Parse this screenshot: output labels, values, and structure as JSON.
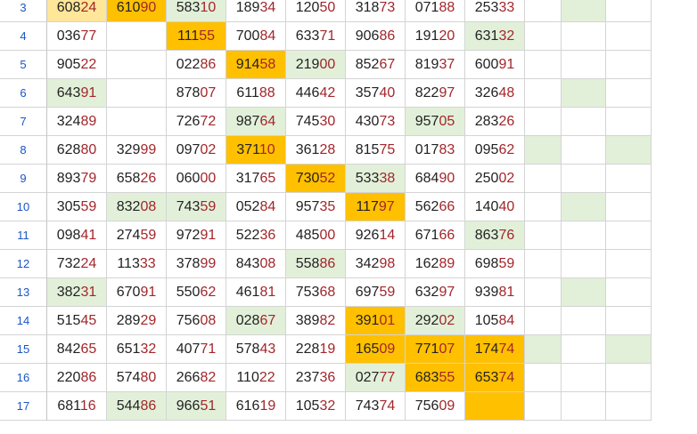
{
  "sheet": {
    "row_numbers": [
      "3",
      "4",
      "5",
      "6",
      "7",
      "8",
      "9",
      "10",
      "11",
      "12",
      "13",
      "14",
      "15",
      "16",
      "17"
    ],
    "highlight_colors": {
      "none": "#ffffff",
      "light_green": "#e2f0d9",
      "orange": "#ffc000",
      "light_orange": "#ffe699",
      "row_number_color": "#1a56c4",
      "first_three_digits": "#222222",
      "last_two_digits": "#a3262b"
    },
    "rows": [
      {
        "cells": [
          {
            "v": "60824",
            "f": 3
          },
          {
            "v": "61090",
            "f": 2
          },
          {
            "v": "58310",
            "f": 1
          },
          {
            "v": "18934",
            "f": 0
          },
          {
            "v": "12050",
            "f": 0
          },
          {
            "v": "31873",
            "f": 0
          },
          {
            "v": "07188",
            "f": 0
          },
          {
            "v": "25333",
            "f": 0
          },
          {
            "v": "",
            "f": 0
          },
          {
            "v": "",
            "f": 1
          },
          {
            "v": "",
            "f": 0
          }
        ]
      },
      {
        "cells": [
          {
            "v": "03677",
            "f": 0
          },
          {
            "v": "",
            "f": 0
          },
          {
            "v": "11155",
            "f": 2
          },
          {
            "v": "70084",
            "f": 0
          },
          {
            "v": "63371",
            "f": 0
          },
          {
            "v": "90686",
            "f": 0
          },
          {
            "v": "19120",
            "f": 0
          },
          {
            "v": "63132",
            "f": 1
          },
          {
            "v": "",
            "f": 0
          },
          {
            "v": "",
            "f": 0
          },
          {
            "v": "",
            "f": 0
          }
        ]
      },
      {
        "cells": [
          {
            "v": "90522",
            "f": 0
          },
          {
            "v": "",
            "f": 0
          },
          {
            "v": "02286",
            "f": 0
          },
          {
            "v": "91458",
            "f": 2
          },
          {
            "v": "21900",
            "f": 1
          },
          {
            "v": "85267",
            "f": 0
          },
          {
            "v": "81937",
            "f": 0
          },
          {
            "v": "60091",
            "f": 0
          },
          {
            "v": "",
            "f": 0
          },
          {
            "v": "",
            "f": 0
          },
          {
            "v": "",
            "f": 0
          }
        ]
      },
      {
        "cells": [
          {
            "v": "64391",
            "f": 1
          },
          {
            "v": "",
            "f": 0
          },
          {
            "v": "87807",
            "f": 0
          },
          {
            "v": "61188",
            "f": 0
          },
          {
            "v": "44642",
            "f": 0
          },
          {
            "v": "35740",
            "f": 0
          },
          {
            "v": "82297",
            "f": 0
          },
          {
            "v": "32648",
            "f": 0
          },
          {
            "v": "",
            "f": 0
          },
          {
            "v": "",
            "f": 1
          },
          {
            "v": "",
            "f": 0
          }
        ]
      },
      {
        "cells": [
          {
            "v": "32489",
            "f": 0
          },
          {
            "v": "",
            "f": 0
          },
          {
            "v": "72672",
            "f": 0
          },
          {
            "v": "98764",
            "f": 1
          },
          {
            "v": "74530",
            "f": 0
          },
          {
            "v": "43073",
            "f": 0
          },
          {
            "v": "95705",
            "f": 1
          },
          {
            "v": "28326",
            "f": 0
          },
          {
            "v": "",
            "f": 0
          },
          {
            "v": "",
            "f": 0
          },
          {
            "v": "",
            "f": 0
          }
        ]
      },
      {
        "cells": [
          {
            "v": "62880",
            "f": 0
          },
          {
            "v": "32999",
            "f": 0
          },
          {
            "v": "09702",
            "f": 0
          },
          {
            "v": "37110",
            "f": 2
          },
          {
            "v": "36128",
            "f": 0
          },
          {
            "v": "81575",
            "f": 0
          },
          {
            "v": "01783",
            "f": 0
          },
          {
            "v": "09562",
            "f": 0
          },
          {
            "v": "",
            "f": 1
          },
          {
            "v": "",
            "f": 0
          },
          {
            "v": "",
            "f": 1
          }
        ]
      },
      {
        "cells": [
          {
            "v": "89379",
            "f": 0
          },
          {
            "v": "65826",
            "f": 0
          },
          {
            "v": "06000",
            "f": 0
          },
          {
            "v": "31765",
            "f": 0
          },
          {
            "v": "73052",
            "f": 2
          },
          {
            "v": "53338",
            "f": 1
          },
          {
            "v": "68490",
            "f": 0
          },
          {
            "v": "25002",
            "f": 0
          },
          {
            "v": "",
            "f": 0
          },
          {
            "v": "",
            "f": 0
          },
          {
            "v": "",
            "f": 0
          }
        ]
      },
      {
        "cells": [
          {
            "v": "30559",
            "f": 0
          },
          {
            "v": "83208",
            "f": 1
          },
          {
            "v": "74359",
            "f": 1
          },
          {
            "v": "05284",
            "f": 0
          },
          {
            "v": "95735",
            "f": 0
          },
          {
            "v": "11797",
            "f": 2
          },
          {
            "v": "56266",
            "f": 0
          },
          {
            "v": "14040",
            "f": 0
          },
          {
            "v": "",
            "f": 0
          },
          {
            "v": "",
            "f": 1
          },
          {
            "v": "",
            "f": 0
          }
        ]
      },
      {
        "cells": [
          {
            "v": "09841",
            "f": 0
          },
          {
            "v": "27459",
            "f": 0
          },
          {
            "v": "97291",
            "f": 0
          },
          {
            "v": "52236",
            "f": 0
          },
          {
            "v": "48500",
            "f": 0
          },
          {
            "v": "92614",
            "f": 0
          },
          {
            "v": "67166",
            "f": 0
          },
          {
            "v": "86376",
            "f": 1
          },
          {
            "v": "",
            "f": 0
          },
          {
            "v": "",
            "f": 0
          },
          {
            "v": "",
            "f": 0
          }
        ]
      },
      {
        "cells": [
          {
            "v": "73224",
            "f": 0
          },
          {
            "v": "11333",
            "f": 0
          },
          {
            "v": "37899",
            "f": 0
          },
          {
            "v": "84308",
            "f": 0
          },
          {
            "v": "55886",
            "f": 1
          },
          {
            "v": "34298",
            "f": 0
          },
          {
            "v": "16289",
            "f": 0
          },
          {
            "v": "69859",
            "f": 0
          },
          {
            "v": "",
            "f": 0
          },
          {
            "v": "",
            "f": 0
          },
          {
            "v": "",
            "f": 0
          }
        ]
      },
      {
        "cells": [
          {
            "v": "38231",
            "f": 1
          },
          {
            "v": "67091",
            "f": 0
          },
          {
            "v": "55062",
            "f": 0
          },
          {
            "v": "46181",
            "f": 0
          },
          {
            "v": "75368",
            "f": 0
          },
          {
            "v": "69759",
            "f": 0
          },
          {
            "v": "63297",
            "f": 0
          },
          {
            "v": "93981",
            "f": 0
          },
          {
            "v": "",
            "f": 0
          },
          {
            "v": "",
            "f": 1
          },
          {
            "v": "",
            "f": 0
          }
        ]
      },
      {
        "cells": [
          {
            "v": "51545",
            "f": 0
          },
          {
            "v": "28929",
            "f": 0
          },
          {
            "v": "75608",
            "f": 0
          },
          {
            "v": "02867",
            "f": 1
          },
          {
            "v": "38982",
            "f": 0
          },
          {
            "v": "39101",
            "f": 2
          },
          {
            "v": "29202",
            "f": 1
          },
          {
            "v": "10584",
            "f": 0
          },
          {
            "v": "",
            "f": 0
          },
          {
            "v": "",
            "f": 0
          },
          {
            "v": "",
            "f": 0
          }
        ]
      },
      {
        "cells": [
          {
            "v": "84265",
            "f": 0
          },
          {
            "v": "65132",
            "f": 0
          },
          {
            "v": "40771",
            "f": 0
          },
          {
            "v": "57843",
            "f": 0
          },
          {
            "v": "22819",
            "f": 0
          },
          {
            "v": "16509",
            "f": 2
          },
          {
            "v": "77107",
            "f": 2
          },
          {
            "v": "17474",
            "f": 2
          },
          {
            "v": "",
            "f": 1
          },
          {
            "v": "",
            "f": 0
          },
          {
            "v": "",
            "f": 1
          }
        ]
      },
      {
        "cells": [
          {
            "v": "22086",
            "f": 0
          },
          {
            "v": "57480",
            "f": 0
          },
          {
            "v": "26682",
            "f": 0
          },
          {
            "v": "11022",
            "f": 0
          },
          {
            "v": "23736",
            "f": 0
          },
          {
            "v": "02777",
            "f": 1
          },
          {
            "v": "68355",
            "f": 2
          },
          {
            "v": "65374",
            "f": 2
          },
          {
            "v": "",
            "f": 0
          },
          {
            "v": "",
            "f": 0
          },
          {
            "v": "",
            "f": 0
          }
        ]
      },
      {
        "cells": [
          {
            "v": "68116",
            "f": 0
          },
          {
            "v": "54486",
            "f": 1
          },
          {
            "v": "96651",
            "f": 1
          },
          {
            "v": "61619",
            "f": 0
          },
          {
            "v": "10532",
            "f": 0
          },
          {
            "v": "74374",
            "f": 0
          },
          {
            "v": "75609",
            "f": 0
          },
          {
            "v": "",
            "f": 2
          },
          {
            "v": "",
            "f": 0
          },
          {
            "v": "",
            "f": 0
          },
          {
            "v": "",
            "f": 0
          }
        ]
      }
    ]
  }
}
